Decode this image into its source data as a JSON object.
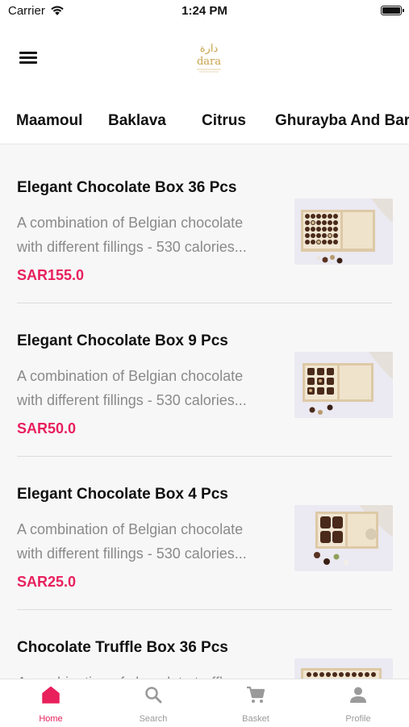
{
  "status_bar": {
    "carrier": "Carrier",
    "time": "1:24 PM"
  },
  "header": {
    "logo_text": "dara",
    "logo_arabic": "دارة"
  },
  "categories": [
    "Maamoul",
    "Baklava",
    "Citrus",
    "Ghurayba And Bar"
  ],
  "products": [
    {
      "title": "Elegant Chocolate Box 36 Pcs",
      "description_line1": "A combination of Belgian chocolate",
      "description_line2": "with different fillings - 530 calories...",
      "price": "SAR155.0"
    },
    {
      "title": "Elegant Chocolate Box 9 Pcs",
      "description_line1": "A combination of Belgian chocolate",
      "description_line2": "with different fillings - 530 calories...",
      "price": "SAR50.0"
    },
    {
      "title": "Elegant Chocolate Box 4 Pcs",
      "description_line1": "A combination of Belgian chocolate",
      "description_line2": "with different fillings - 530 calories...",
      "price": "SAR25.0"
    },
    {
      "title": "Chocolate Truffle Box 36 Pcs",
      "description_line1": "A combination of chocolate truffle",
      "description_line2": "",
      "price": ""
    }
  ],
  "tabbar": {
    "items": [
      {
        "label": "Home",
        "icon": "home-icon",
        "active": true
      },
      {
        "label": "Search",
        "icon": "search-icon",
        "active": false
      },
      {
        "label": "Basket",
        "icon": "cart-icon",
        "active": false
      },
      {
        "label": "Profile",
        "icon": "profile-icon",
        "active": false
      }
    ]
  },
  "colors": {
    "accent": "#e8205c",
    "muted": "#8a8a8a",
    "gold": "#c8a24a",
    "list_bg": "#f7f7f8"
  }
}
